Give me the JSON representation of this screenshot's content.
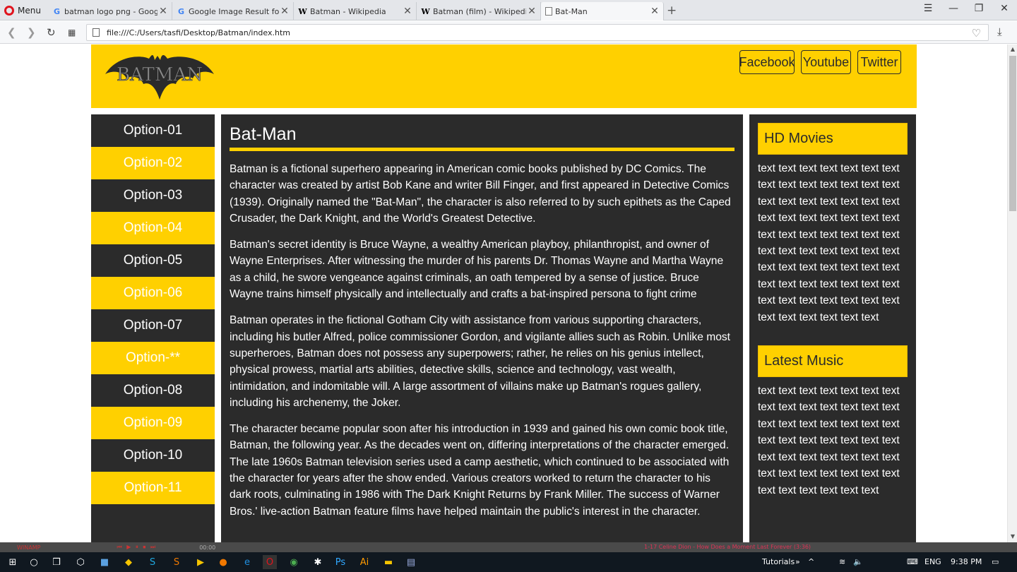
{
  "browser": {
    "menu_label": "Menu",
    "tabs": [
      {
        "title": "batman logo png - Google",
        "icon": "google-icon"
      },
      {
        "title": "Google Image Result for h",
        "icon": "google-icon"
      },
      {
        "title": "Batman - Wikipedia",
        "icon": "wikipedia-icon"
      },
      {
        "title": "Batman (film) - Wikipedia",
        "icon": "wikipedia-icon"
      },
      {
        "title": "Bat-Man",
        "icon": "page-icon",
        "active": true
      }
    ],
    "url": "file:///C:/Users/tasfi/Desktop/Batman/index.htm"
  },
  "site": {
    "logo_text": "BATMAN",
    "social": [
      "Facebook",
      "Youtube",
      "Twitter"
    ],
    "sidebar": [
      "Option-01",
      "Option-02",
      "Option-03",
      "Option-04",
      "Option-05",
      "Option-06",
      "Option-07",
      "Option-**",
      "Option-08",
      "Option-09",
      "Option-10",
      "Option-11"
    ],
    "main": {
      "title": "Bat-Man",
      "paragraphs": [
        "Batman is a fictional superhero appearing in American comic books published by DC Comics. The character was created by artist Bob Kane and writer Bill Finger, and first appeared in Detective Comics (1939). Originally named the \"Bat-Man\", the character is also referred to by such epithets as the Caped Crusader, the Dark Knight, and the World's Greatest Detective.",
        "Batman's secret identity is Bruce Wayne, a wealthy American playboy, philanthropist, and owner of Wayne Enterprises. After witnessing the murder of his parents Dr. Thomas Wayne and Martha Wayne as a child, he swore vengeance against criminals, an oath tempered by a sense of justice. Bruce Wayne trains himself physically and intellectually and crafts a bat-inspired persona to fight crime",
        "Batman operates in the fictional Gotham City with assistance from various supporting characters, including his butler Alfred, police commissioner Gordon, and vigilante allies such as Robin. Unlike most superheroes, Batman does not possess any superpowers; rather, he relies on his genius intellect, physical prowess, martial arts abilities, detective skills, science and technology, vast wealth, intimidation, and indomitable will. A large assortment of villains make up Batman's rogues gallery, including his archenemy, the Joker.",
        "The character became popular soon after his introduction in 1939 and gained his own comic book title, Batman, the following year. As the decades went on, differing interpretations of the character emerged. The late 1960s Batman television series used a camp aesthetic, which continued to be associated with the character for years after the show ended. Various creators worked to return the character to his dark roots, culminating in 1986 with The Dark Knight Returns by Frank Miller. The success of Warner Bros.' live-action Batman feature films have helped maintain the public's interest in the character."
      ]
    },
    "right": {
      "hd_movies_title": "HD Movies",
      "hd_movies_text": "text text text text text text text text text text text text text text text text text text text text text text text text text text text text text text text text text text text text text text text text text text text text text text text text text text text text text text text text text text text text text text text text text text text text text",
      "latest_music_title": "Latest Music",
      "latest_music_text": "text text text text text text text text text text text text text text text text text text text text text text text text text text text text text text text text text text text text text text text text text text text text text text text text"
    }
  },
  "winamp": {
    "label": "WINAMP",
    "time": "00:00",
    "track": "1-17 Celine Dion - How Does a Moment Last Forever (3:36)"
  },
  "taskbar": {
    "tray_label": "Tutorials",
    "lang": "ENG",
    "clock": "9:38 PM"
  },
  "colors": {
    "accent": "#ffd000",
    "panel": "#2b2b2b"
  }
}
